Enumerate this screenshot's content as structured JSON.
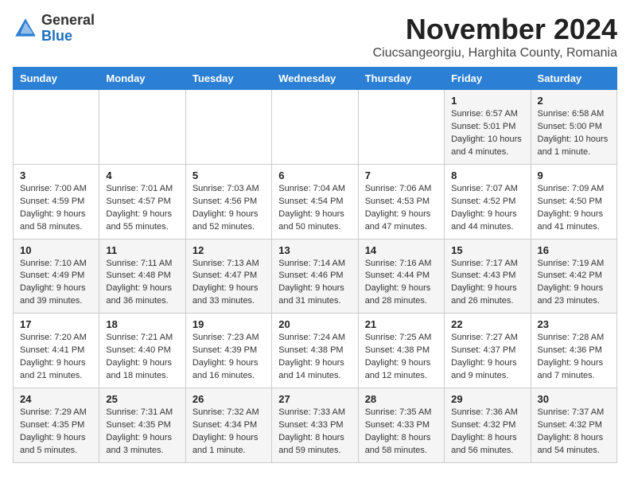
{
  "header": {
    "logo_general": "General",
    "logo_blue": "Blue",
    "month_title": "November 2024",
    "location": "Ciucsangeorgiu, Harghita County, Romania"
  },
  "weekdays": [
    "Sunday",
    "Monday",
    "Tuesday",
    "Wednesday",
    "Thursday",
    "Friday",
    "Saturday"
  ],
  "weeks": [
    [
      {
        "day": "",
        "detail": ""
      },
      {
        "day": "",
        "detail": ""
      },
      {
        "day": "",
        "detail": ""
      },
      {
        "day": "",
        "detail": ""
      },
      {
        "day": "",
        "detail": ""
      },
      {
        "day": "1",
        "detail": "Sunrise: 6:57 AM\nSunset: 5:01 PM\nDaylight: 10 hours\nand 4 minutes."
      },
      {
        "day": "2",
        "detail": "Sunrise: 6:58 AM\nSunset: 5:00 PM\nDaylight: 10 hours\nand 1 minute."
      }
    ],
    [
      {
        "day": "3",
        "detail": "Sunrise: 7:00 AM\nSunset: 4:59 PM\nDaylight: 9 hours\nand 58 minutes."
      },
      {
        "day": "4",
        "detail": "Sunrise: 7:01 AM\nSunset: 4:57 PM\nDaylight: 9 hours\nand 55 minutes."
      },
      {
        "day": "5",
        "detail": "Sunrise: 7:03 AM\nSunset: 4:56 PM\nDaylight: 9 hours\nand 52 minutes."
      },
      {
        "day": "6",
        "detail": "Sunrise: 7:04 AM\nSunset: 4:54 PM\nDaylight: 9 hours\nand 50 minutes."
      },
      {
        "day": "7",
        "detail": "Sunrise: 7:06 AM\nSunset: 4:53 PM\nDaylight: 9 hours\nand 47 minutes."
      },
      {
        "day": "8",
        "detail": "Sunrise: 7:07 AM\nSunset: 4:52 PM\nDaylight: 9 hours\nand 44 minutes."
      },
      {
        "day": "9",
        "detail": "Sunrise: 7:09 AM\nSunset: 4:50 PM\nDaylight: 9 hours\nand 41 minutes."
      }
    ],
    [
      {
        "day": "10",
        "detail": "Sunrise: 7:10 AM\nSunset: 4:49 PM\nDaylight: 9 hours\nand 39 minutes."
      },
      {
        "day": "11",
        "detail": "Sunrise: 7:11 AM\nSunset: 4:48 PM\nDaylight: 9 hours\nand 36 minutes."
      },
      {
        "day": "12",
        "detail": "Sunrise: 7:13 AM\nSunset: 4:47 PM\nDaylight: 9 hours\nand 33 minutes."
      },
      {
        "day": "13",
        "detail": "Sunrise: 7:14 AM\nSunset: 4:46 PM\nDaylight: 9 hours\nand 31 minutes."
      },
      {
        "day": "14",
        "detail": "Sunrise: 7:16 AM\nSunset: 4:44 PM\nDaylight: 9 hours\nand 28 minutes."
      },
      {
        "day": "15",
        "detail": "Sunrise: 7:17 AM\nSunset: 4:43 PM\nDaylight: 9 hours\nand 26 minutes."
      },
      {
        "day": "16",
        "detail": "Sunrise: 7:19 AM\nSunset: 4:42 PM\nDaylight: 9 hours\nand 23 minutes."
      }
    ],
    [
      {
        "day": "17",
        "detail": "Sunrise: 7:20 AM\nSunset: 4:41 PM\nDaylight: 9 hours\nand 21 minutes."
      },
      {
        "day": "18",
        "detail": "Sunrise: 7:21 AM\nSunset: 4:40 PM\nDaylight: 9 hours\nand 18 minutes."
      },
      {
        "day": "19",
        "detail": "Sunrise: 7:23 AM\nSunset: 4:39 PM\nDaylight: 9 hours\nand 16 minutes."
      },
      {
        "day": "20",
        "detail": "Sunrise: 7:24 AM\nSunset: 4:38 PM\nDaylight: 9 hours\nand 14 minutes."
      },
      {
        "day": "21",
        "detail": "Sunrise: 7:25 AM\nSunset: 4:38 PM\nDaylight: 9 hours\nand 12 minutes."
      },
      {
        "day": "22",
        "detail": "Sunrise: 7:27 AM\nSunset: 4:37 PM\nDaylight: 9 hours\nand 9 minutes."
      },
      {
        "day": "23",
        "detail": "Sunrise: 7:28 AM\nSunset: 4:36 PM\nDaylight: 9 hours\nand 7 minutes."
      }
    ],
    [
      {
        "day": "24",
        "detail": "Sunrise: 7:29 AM\nSunset: 4:35 PM\nDaylight: 9 hours\nand 5 minutes."
      },
      {
        "day": "25",
        "detail": "Sunrise: 7:31 AM\nSunset: 4:35 PM\nDaylight: 9 hours\nand 3 minutes."
      },
      {
        "day": "26",
        "detail": "Sunrise: 7:32 AM\nSunset: 4:34 PM\nDaylight: 9 hours\nand 1 minute."
      },
      {
        "day": "27",
        "detail": "Sunrise: 7:33 AM\nSunset: 4:33 PM\nDaylight: 8 hours\nand 59 minutes."
      },
      {
        "day": "28",
        "detail": "Sunrise: 7:35 AM\nSunset: 4:33 PM\nDaylight: 8 hours\nand 58 minutes."
      },
      {
        "day": "29",
        "detail": "Sunrise: 7:36 AM\nSunset: 4:32 PM\nDaylight: 8 hours\nand 56 minutes."
      },
      {
        "day": "30",
        "detail": "Sunrise: 7:37 AM\nSunset: 4:32 PM\nDaylight: 8 hours\nand 54 minutes."
      }
    ]
  ]
}
